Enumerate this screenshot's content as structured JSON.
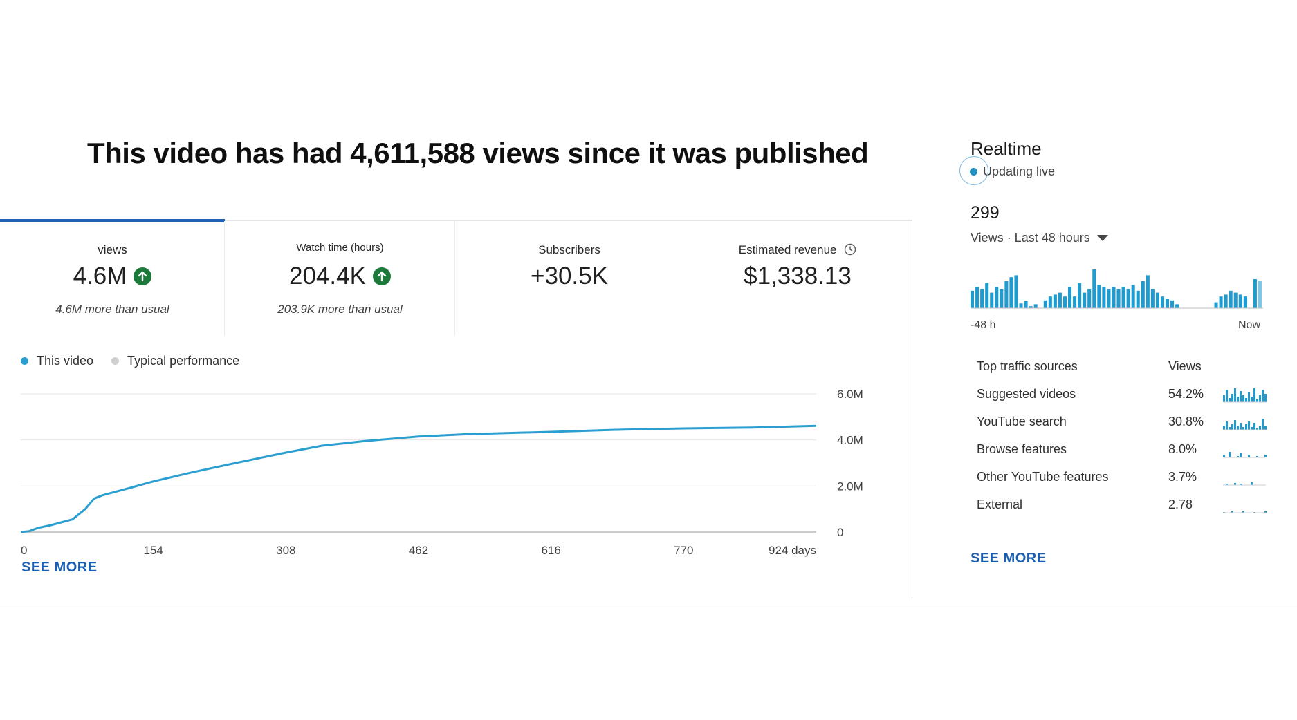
{
  "headline": "This video has had 4,611,588 views since it was published",
  "metrics": [
    {
      "label": "views",
      "value": "4.6M",
      "note": "4.6M more than usual",
      "trend": "up",
      "selected": true
    },
    {
      "label": "Watch time (hours)",
      "value": "204.4K",
      "note": "203.9K more than usual",
      "trend": "up",
      "selected": false
    },
    {
      "label": "Subscribers",
      "value": "+30.5K",
      "note": "",
      "trend": "",
      "selected": false
    },
    {
      "label": "Estimated revenue",
      "value": "$1,338.13",
      "note": "",
      "trend": "",
      "selected": false
    }
  ],
  "legend": {
    "this_video": "This video",
    "typical": "Typical performance"
  },
  "chart_data": {
    "type": "line",
    "title": "",
    "xlabel": "",
    "ylabel": "",
    "x_unit": "days",
    "x_ticks": [
      "0",
      "154",
      "308",
      "462",
      "616",
      "770",
      "924 days"
    ],
    "y_ticks": [
      "6.0M",
      "4.0M",
      "2.0M",
      "0"
    ],
    "xlim": [
      0,
      924
    ],
    "ylim": [
      0,
      6000000
    ],
    "grid": true,
    "series": [
      {
        "name": "This video",
        "color": "#2a9fd0",
        "x": [
          0,
          10,
          20,
          35,
          50,
          60,
          75,
          85,
          95,
          110,
          130,
          154,
          200,
          250,
          308,
          350,
          400,
          462,
          520,
          616,
          700,
          770,
          850,
          924
        ],
        "y": [
          0,
          40000,
          180000,
          300000,
          450000,
          550000,
          1000000,
          1450000,
          1600000,
          1750000,
          1950000,
          2200000,
          2600000,
          3000000,
          3450000,
          3750000,
          3950000,
          4150000,
          4250000,
          4350000,
          4450000,
          4500000,
          4540000,
          4610000
        ]
      }
    ]
  },
  "see_more": "SEE MORE",
  "realtime": {
    "title": "Realtime",
    "status": "Updating live",
    "count": "299",
    "range_label": "Views · Last 48 hours",
    "bars": [
      0.45,
      0.55,
      0.5,
      0.65,
      0.4,
      0.55,
      0.5,
      0.7,
      0.8,
      0.85,
      0.12,
      0.18,
      0.05,
      0.1,
      0.0,
      0.2,
      0.3,
      0.35,
      0.4,
      0.3,
      0.55,
      0.3,
      0.65,
      0.4,
      0.5,
      1.0,
      0.6,
      0.55,
      0.5,
      0.55,
      0.5,
      0.55,
      0.5,
      0.6,
      0.45,
      0.7,
      0.85,
      0.5,
      0.4,
      0.3,
      0.25,
      0.2,
      0.1,
      0.0,
      0.0,
      0.0,
      0.0,
      0.0,
      0.0,
      0.0,
      0.15,
      0.3,
      0.35,
      0.45,
      0.4,
      0.35,
      0.3,
      0.0,
      0.75,
      0.7
    ],
    "axis_start": "-48 h",
    "axis_end": "Now",
    "traffic_header": {
      "source": "Top traffic sources",
      "views": "Views"
    },
    "traffic_sources": [
      {
        "name": "Suggested videos",
        "pct": "54.2%"
      },
      {
        "name": "YouTube search",
        "pct": "30.8%"
      },
      {
        "name": "Browse features",
        "pct": "8.0%"
      },
      {
        "name": "Other YouTube features",
        "pct": "3.7%"
      },
      {
        "name": "External",
        "pct": "2.78"
      }
    ],
    "see_more": "SEE MORE"
  }
}
